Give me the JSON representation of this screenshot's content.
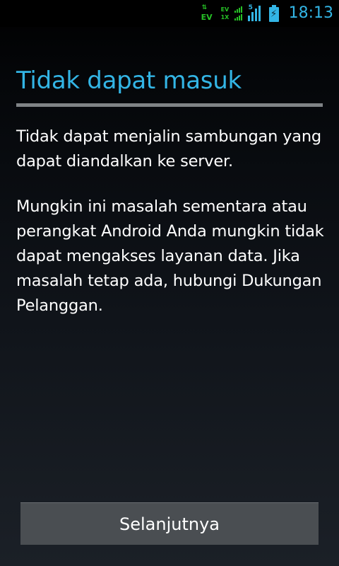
{
  "status_bar": {
    "data_icon": "data-activity-ev-icon",
    "data_label": "EV",
    "evdo_label_1": "EV",
    "evdo_label_2": "1X",
    "signal_icon": "signal-strength-icon",
    "signal_label": "5",
    "battery_icon": "battery-charging-icon",
    "time": "18:13",
    "colors": {
      "accent": "#33b5e5",
      "network": "#26c026"
    }
  },
  "dialog": {
    "title": "Tidak dapat masuk",
    "message_1": "Tidak dapat menjalin sambungan yang dapat diandalkan ke server.",
    "message_2": "Mungkin ini masalah sementara atau perangkat Android Anda mungkin tidak dapat mengakses layanan data. Jika masalah tetap ada, hubungi Dukungan Pelanggan.",
    "next_button_label": "Selanjutnya"
  },
  "colors": {
    "title": "#33b5e5",
    "divider": "#7f8386",
    "button_bg": "#4a4e52"
  }
}
